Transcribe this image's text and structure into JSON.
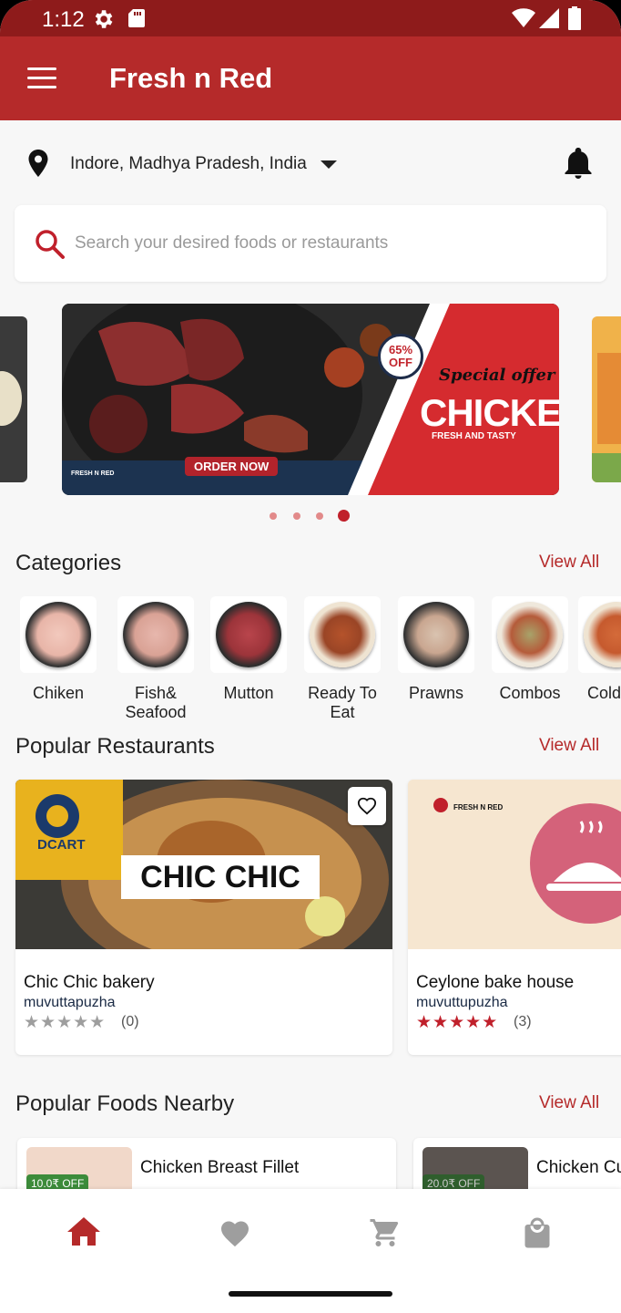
{
  "status_bar": {
    "time": "1:12"
  },
  "app_bar": {
    "title": "Fresh n Red"
  },
  "location": {
    "label": "Indore, Madhya Pradesh, India"
  },
  "search": {
    "placeholder": "Search your desired foods or restaurants"
  },
  "banner": {
    "discount_line1": "65%",
    "discount_line2": "OFF",
    "special": "Special offer",
    "headline": "CHICKEN",
    "tagline": "FRESH AND TASTY",
    "cta": "ORDER NOW",
    "logo_text": "FRESH N RED",
    "slide_count": 4,
    "active_slide": 4
  },
  "categories": {
    "title": "Categories",
    "view_all": "View All",
    "items": [
      {
        "label": "Chiken"
      },
      {
        "label": "Fish& Seafood"
      },
      {
        "label": "Mutton"
      },
      {
        "label": "Ready To Eat"
      },
      {
        "label": "Prawns"
      },
      {
        "label": "Combos"
      },
      {
        "label": "Cold"
      }
    ]
  },
  "restaurants": {
    "title": "Popular Restaurants",
    "view_all": "View All",
    "items": [
      {
        "name": "Chic Chic bakery",
        "location": "muvuttapuzha",
        "rating": 0,
        "rating_count": "(0)",
        "image_text": "CHIC CHIC",
        "image_logo": "DCART"
      },
      {
        "name": "Ceylone bake house",
        "location": "muvuttupuzha",
        "rating": 5,
        "rating_count": "(3)",
        "image_logo": "FRESH N RED"
      }
    ]
  },
  "foods": {
    "title": "Popular Foods Nearby",
    "view_all": "View All",
    "items": [
      {
        "name": "Chicken Breast Fillet",
        "discount": "10.0₹ OFF"
      },
      {
        "name": "Chicken Cu",
        "discount": "20.0₹ OFF"
      }
    ]
  },
  "colors": {
    "primary": "#b52a2a",
    "status_bar": "#8e1b1b",
    "star_active": "#c0202b",
    "star_inactive": "#9e9e9e",
    "discount": "#3c8b3a"
  },
  "bottom_nav": {
    "items": [
      "home-icon",
      "favorites-icon",
      "cart-icon",
      "orders-icon"
    ],
    "active": "home-icon"
  }
}
